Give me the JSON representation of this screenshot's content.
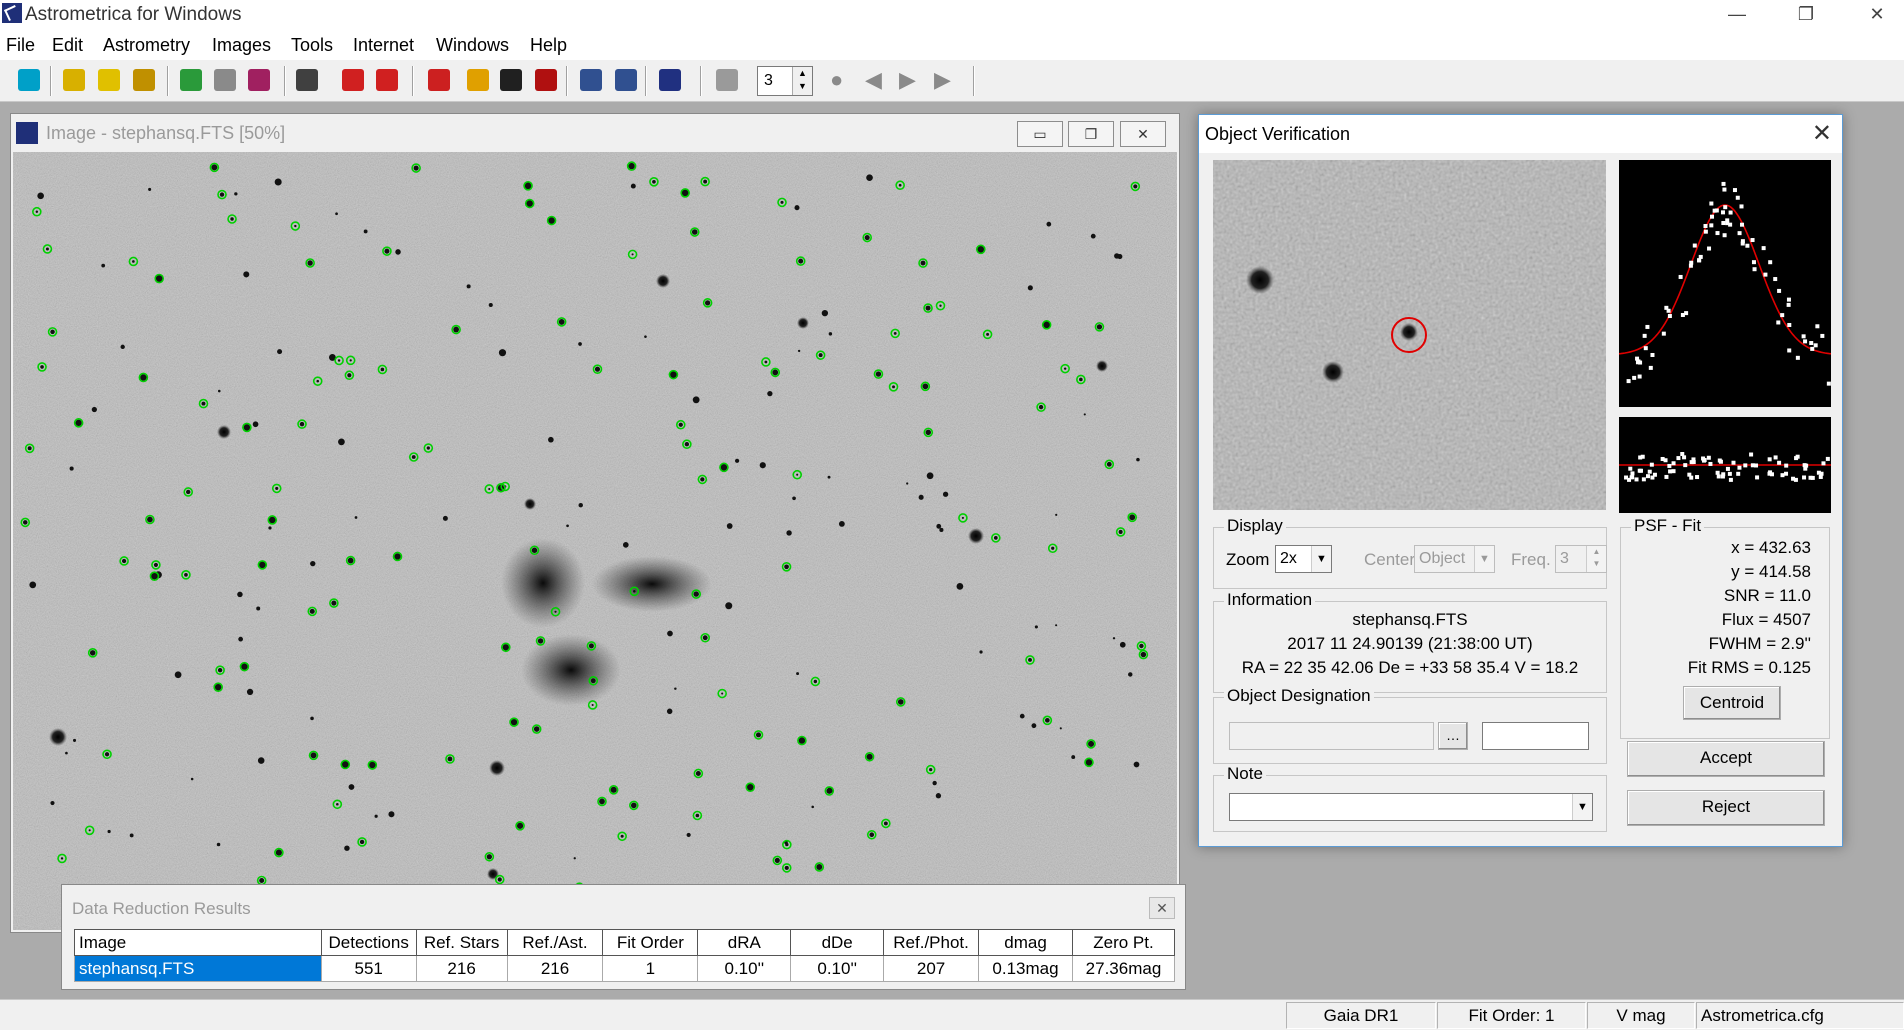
{
  "app": {
    "title": "Astrometrica for Windows",
    "controls": {
      "minimize": "—",
      "restore": "❐",
      "close": "✕"
    }
  },
  "menu": [
    "File",
    "Edit",
    "Astrometry",
    "Images",
    "Tools",
    "Internet",
    "Windows",
    "Help"
  ],
  "toolbar": {
    "buttons": [
      {
        "name": "go-icon",
        "color": "#00a0c8"
      },
      {
        "name": "open-images-icon",
        "color": "#d8b000"
      },
      {
        "name": "open-folder-icon",
        "color": "#e0c000"
      },
      {
        "name": "load-images-icon",
        "color": "#c09000"
      },
      {
        "name": "add-star-icon",
        "color": "#2a9a3a"
      },
      {
        "name": "remove-star-icon",
        "color": "#8a8a8a"
      },
      {
        "name": "reduction-icon",
        "color": "#a02060"
      },
      {
        "name": "report-icon",
        "color": "#404040"
      },
      {
        "name": "delete-red-icon",
        "color": "#d02020"
      },
      {
        "name": "delete-all-icon",
        "color": "#d02020"
      },
      {
        "name": "blink-icon",
        "color": "#cc2020"
      },
      {
        "name": "ring-icon",
        "color": "#e0a000"
      },
      {
        "name": "pen-icon",
        "color": "#202020"
      },
      {
        "name": "starfield-icon",
        "color": "#b01010"
      },
      {
        "name": "zoom-in-icon",
        "color": "#305090"
      },
      {
        "name": "zoom-out-icon",
        "color": "#305090"
      },
      {
        "name": "settings-icon",
        "color": "#203080"
      },
      {
        "name": "track-icon",
        "color": "#9a9a9a"
      }
    ],
    "stack_value": "3",
    "playback": [
      {
        "name": "record-icon",
        "glyph": "●"
      },
      {
        "name": "previous-icon",
        "glyph": "◀"
      },
      {
        "name": "step-forward-icon",
        "glyph": "▶"
      },
      {
        "name": "play-icon",
        "glyph": "▶"
      }
    ]
  },
  "image_window": {
    "title": "Image - stephansq.FTS [50%]",
    "controls": {
      "minimize": "▭",
      "restore": "❐",
      "close": "✕"
    }
  },
  "data_reduction": {
    "title": "Data Reduction Results",
    "close": "✕",
    "columns": [
      "Image",
      "Detections",
      "Ref. Stars",
      "Ref./Ast.",
      "Fit Order",
      "dRA",
      "dDe",
      "Ref./Phot.",
      "dmag",
      "Zero Pt."
    ],
    "row": [
      "stephansq.FTS",
      "551",
      "216",
      "216",
      "1",
      "0.10''",
      "0.10''",
      "207",
      "0.13mag",
      "27.36mag"
    ]
  },
  "verification": {
    "title": "Object Verification",
    "close": "✕",
    "display": {
      "label": "Display",
      "zoom_label": "Zoom",
      "zoom_value": "2x",
      "center_label": "Center",
      "center_value": "Object",
      "freq_label": "Freq.",
      "freq_value": "3"
    },
    "information": {
      "label": "Information",
      "file": "stephansq.FTS",
      "time": "2017 11 24.90139 (21:38:00 UT)",
      "coords": "RA = 22 35 42.06   De = +33 58 35.4   V = 18.2"
    },
    "designation": {
      "label": "Object Designation",
      "browse": "…"
    },
    "note": {
      "label": "Note"
    },
    "psf": {
      "label": "PSF - Fit",
      "lines": [
        "x = 432.63",
        "y = 414.58",
        "SNR = 11.0",
        "Flux = 4507",
        "FWHM = 2.9''",
        "Fit RMS = 0.125"
      ],
      "centroid": "Centroid"
    },
    "accept": "Accept",
    "reject": "Reject"
  },
  "statusbar": [
    "Gaia DR1",
    "Fit Order: 1",
    "V mag",
    "Astrometrica.cfg"
  ],
  "colors": {
    "star_marker": "#00d000",
    "selected_row": "#0078d7",
    "fit_curve": "#e00000"
  }
}
